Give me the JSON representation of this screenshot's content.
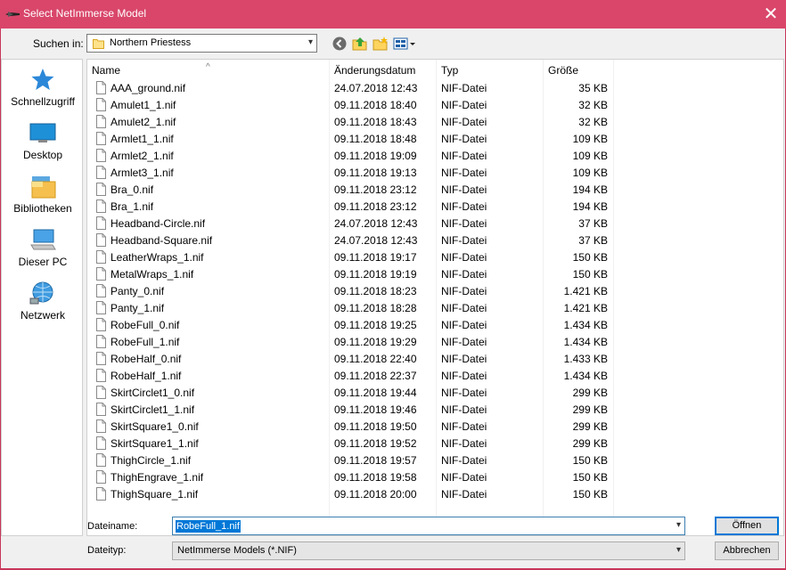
{
  "window": {
    "title": "Select NetImmerse Model",
    "close_glyph": "✕"
  },
  "toolbar": {
    "look_in_label": "Suchen in:",
    "look_in_value": "Northern Priestess"
  },
  "places": [
    {
      "label": "Schnellzugriff",
      "icon": "star-icon"
    },
    {
      "label": "Desktop",
      "icon": "desktop-icon"
    },
    {
      "label": "Bibliotheken",
      "icon": "libraries-icon"
    },
    {
      "label": "Dieser PC",
      "icon": "computer-icon"
    },
    {
      "label": "Netzwerk",
      "icon": "network-icon"
    }
  ],
  "columns": {
    "name": "Name",
    "date": "Änderungsdatum",
    "type": "Typ",
    "size": "Größe"
  },
  "files": [
    {
      "name": "AAA_ground.nif",
      "date": "24.07.2018 12:43",
      "type": "NIF-Datei",
      "size": "35 KB"
    },
    {
      "name": "Amulet1_1.nif",
      "date": "09.11.2018 18:40",
      "type": "NIF-Datei",
      "size": "32 KB"
    },
    {
      "name": "Amulet2_1.nif",
      "date": "09.11.2018 18:43",
      "type": "NIF-Datei",
      "size": "32 KB"
    },
    {
      "name": "Armlet1_1.nif",
      "date": "09.11.2018 18:48",
      "type": "NIF-Datei",
      "size": "109 KB"
    },
    {
      "name": "Armlet2_1.nif",
      "date": "09.11.2018 19:09",
      "type": "NIF-Datei",
      "size": "109 KB"
    },
    {
      "name": "Armlet3_1.nif",
      "date": "09.11.2018 19:13",
      "type": "NIF-Datei",
      "size": "109 KB"
    },
    {
      "name": "Bra_0.nif",
      "date": "09.11.2018 23:12",
      "type": "NIF-Datei",
      "size": "194 KB"
    },
    {
      "name": "Bra_1.nif",
      "date": "09.11.2018 23:12",
      "type": "NIF-Datei",
      "size": "194 KB"
    },
    {
      "name": "Headband-Circle.nif",
      "date": "24.07.2018 12:43",
      "type": "NIF-Datei",
      "size": "37 KB"
    },
    {
      "name": "Headband-Square.nif",
      "date": "24.07.2018 12:43",
      "type": "NIF-Datei",
      "size": "37 KB"
    },
    {
      "name": "LeatherWraps_1.nif",
      "date": "09.11.2018 19:17",
      "type": "NIF-Datei",
      "size": "150 KB"
    },
    {
      "name": "MetalWraps_1.nif",
      "date": "09.11.2018 19:19",
      "type": "NIF-Datei",
      "size": "150 KB"
    },
    {
      "name": "Panty_0.nif",
      "date": "09.11.2018 18:23",
      "type": "NIF-Datei",
      "size": "1.421 KB"
    },
    {
      "name": "Panty_1.nif",
      "date": "09.11.2018 18:28",
      "type": "NIF-Datei",
      "size": "1.421 KB"
    },
    {
      "name": "RobeFull_0.nif",
      "date": "09.11.2018 19:25",
      "type": "NIF-Datei",
      "size": "1.434 KB"
    },
    {
      "name": "RobeFull_1.nif",
      "date": "09.11.2018 19:29",
      "type": "NIF-Datei",
      "size": "1.434 KB"
    },
    {
      "name": "RobeHalf_0.nif",
      "date": "09.11.2018 22:40",
      "type": "NIF-Datei",
      "size": "1.433 KB"
    },
    {
      "name": "RobeHalf_1.nif",
      "date": "09.11.2018 22:37",
      "type": "NIF-Datei",
      "size": "1.434 KB"
    },
    {
      "name": "SkirtCirclet1_0.nif",
      "date": "09.11.2018 19:44",
      "type": "NIF-Datei",
      "size": "299 KB"
    },
    {
      "name": "SkirtCirclet1_1.nif",
      "date": "09.11.2018 19:46",
      "type": "NIF-Datei",
      "size": "299 KB"
    },
    {
      "name": "SkirtSquare1_0.nif",
      "date": "09.11.2018 19:50",
      "type": "NIF-Datei",
      "size": "299 KB"
    },
    {
      "name": "SkirtSquare1_1.nif",
      "date": "09.11.2018 19:52",
      "type": "NIF-Datei",
      "size": "299 KB"
    },
    {
      "name": "ThighCircle_1.nif",
      "date": "09.11.2018 19:57",
      "type": "NIF-Datei",
      "size": "150 KB"
    },
    {
      "name": "ThighEngrave_1.nif",
      "date": "09.11.2018 19:58",
      "type": "NIF-Datei",
      "size": "150 KB"
    },
    {
      "name": "ThighSquare_1.nif",
      "date": "09.11.2018 20:00",
      "type": "NIF-Datei",
      "size": "150 KB"
    }
  ],
  "bottom": {
    "filename_label": "Dateiname:",
    "filename_value": "RobeFull_1.nif",
    "filetype_label": "Dateityp:",
    "filetype_value": "NetImmerse Models (*.NIF)",
    "open_label": "Öffnen",
    "cancel_label": "Abbrechen"
  },
  "colors": {
    "titlebar": "#d9466a",
    "frame": "#c8365a",
    "accent": "#0078d7"
  }
}
